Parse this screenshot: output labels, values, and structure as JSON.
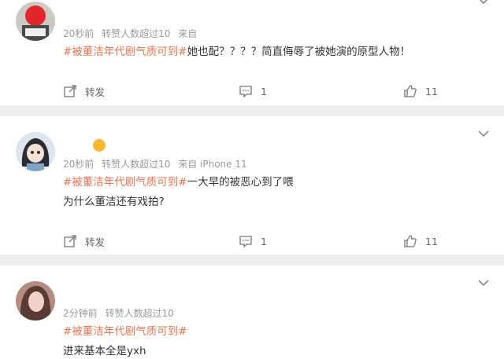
{
  "comments": [
    {
      "time": "20秒前",
      "repost_info": "转赞人数超过10",
      "source": "来自",
      "hashtag": "#被董洁年代剧气质可到#",
      "text": "她也配？？？？简直侮辱了被她演的原型人物！",
      "repost_label": "转发",
      "comment_count": "1",
      "like_count": "11"
    },
    {
      "time": "20秒前",
      "repost_info": "转赞人数超过10",
      "source": "来自 iPhone 11",
      "hashtag": "#被董洁年代剧气质可到#",
      "text": "一大早的被恶心到了喂",
      "text2": "为什么董洁还有戏拍?",
      "repost_label": "转发",
      "comment_count": "1",
      "like_count": "11"
    },
    {
      "time": "2分钟前",
      "repost_info": "转赞人数超过10",
      "hashtag": "#被董洁年代剧气质可到#",
      "text": "进来基本全是yxh"
    }
  ]
}
